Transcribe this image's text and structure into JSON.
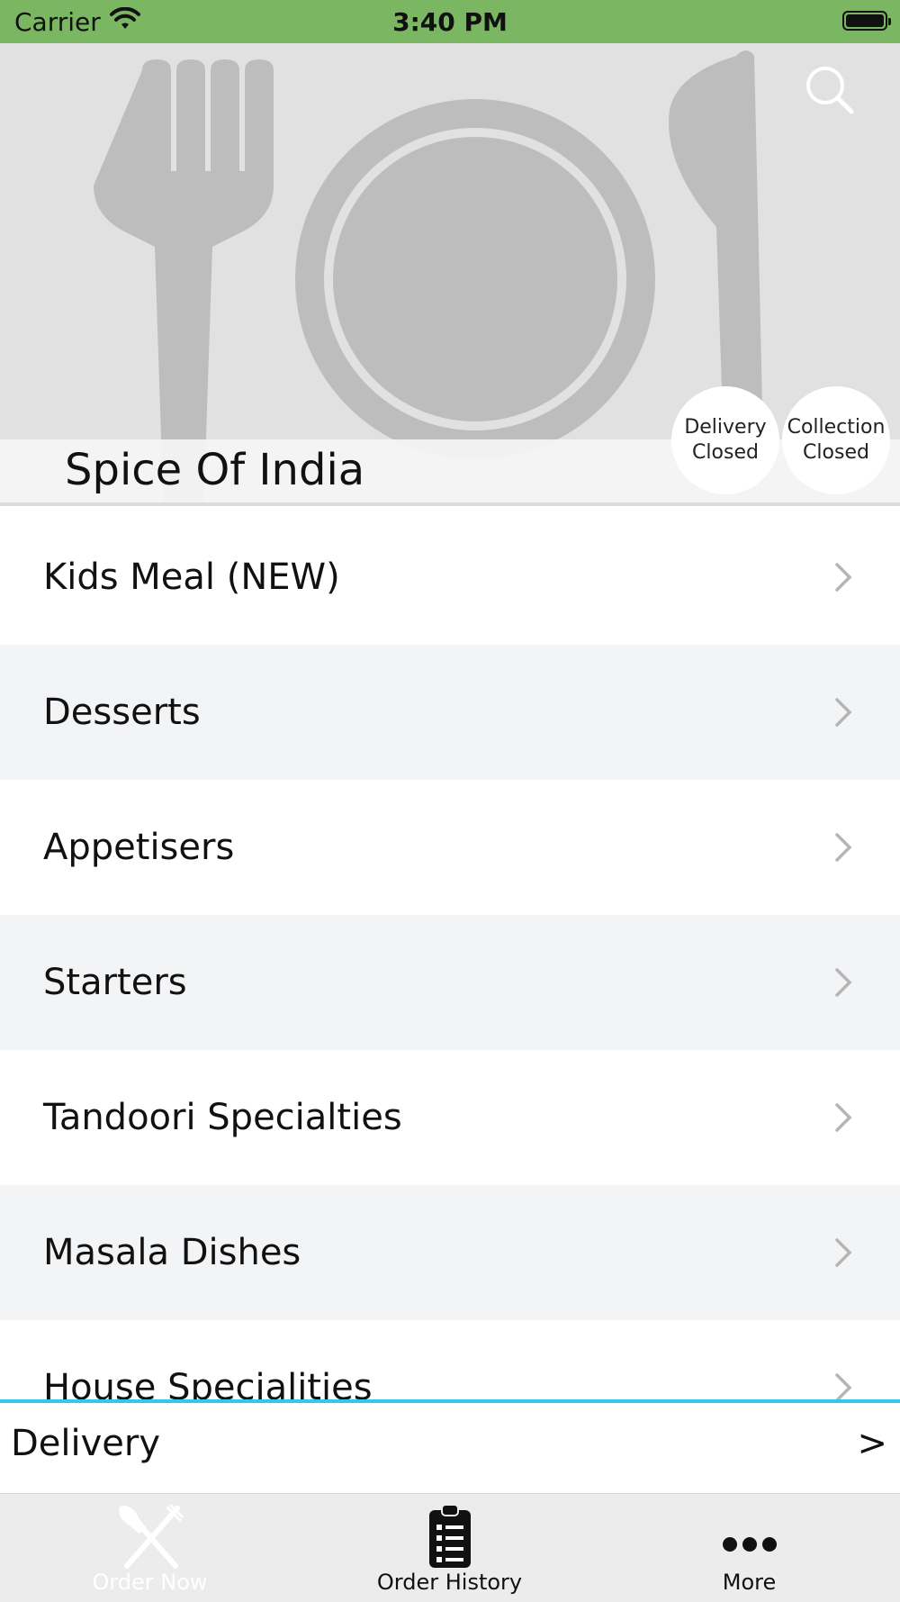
{
  "status_bar": {
    "carrier": "Carrier",
    "time": "3:40 PM"
  },
  "hero": {
    "restaurant_name": "Spice Of India",
    "search_icon": "search-icon",
    "badges": [
      {
        "line1": "Delivery",
        "line2": "Closed"
      },
      {
        "line1": "Collection",
        "line2": "Closed"
      }
    ]
  },
  "menu": {
    "items": [
      {
        "label": "Kids Meal (NEW)"
      },
      {
        "label": "Desserts"
      },
      {
        "label": "Appetisers"
      },
      {
        "label": "Starters"
      },
      {
        "label": "Tandoori Specialties"
      },
      {
        "label": "Masala Dishes"
      },
      {
        "label": "House Specialities"
      }
    ]
  },
  "delivery_bar": {
    "label": "Delivery",
    "arrow": ">"
  },
  "tabs": [
    {
      "label": "Order Now",
      "icon": "fork-knife-icon"
    },
    {
      "label": "Order History",
      "icon": "clipboard-list-icon"
    },
    {
      "label": "More",
      "icon": "more-dots-icon"
    }
  ],
  "colors": {
    "status_bar": "#7bb662",
    "accent_line": "#33c7e8",
    "hero_bg": "#e1e1e1",
    "row_alt": "#f3f4f6"
  }
}
